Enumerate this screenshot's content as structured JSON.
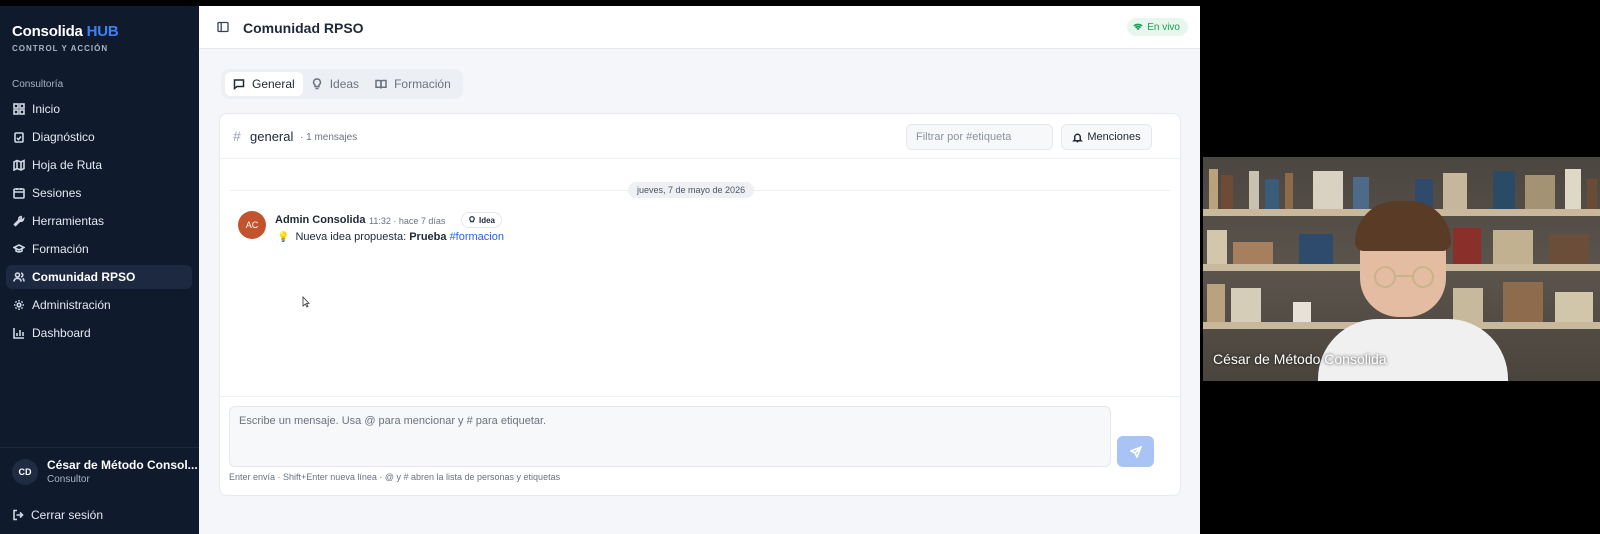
{
  "brand": {
    "name": "Consolida",
    "hub": "HUB",
    "tagline": "CONTROL Y ACCIÓN"
  },
  "sidebar": {
    "section": "Consultoría",
    "items": [
      {
        "label": "Inicio",
        "icon": "grid-icon"
      },
      {
        "label": "Diagnóstico",
        "icon": "clipboard-check-icon"
      },
      {
        "label": "Hoja de Ruta",
        "icon": "map-icon"
      },
      {
        "label": "Sesiones",
        "icon": "calendar-icon"
      },
      {
        "label": "Herramientas",
        "icon": "wrench-icon"
      },
      {
        "label": "Formación",
        "icon": "graduation-cap-icon"
      },
      {
        "label": "Comunidad RPSO",
        "icon": "users-icon",
        "active": true
      },
      {
        "label": "Administración",
        "icon": "gear-icon"
      },
      {
        "label": "Dashboard",
        "icon": "bar-chart-icon"
      }
    ],
    "user": {
      "initials": "CD",
      "name": "César de Método Consol...",
      "role": "Consultor"
    },
    "logout": "Cerrar sesión"
  },
  "header": {
    "title": "Comunidad RPSO",
    "status": "En vivo"
  },
  "tabs": [
    {
      "label": "General",
      "icon": "message-square-icon",
      "active": true
    },
    {
      "label": "Ideas",
      "icon": "lightbulb-icon"
    },
    {
      "label": "Formación",
      "icon": "book-open-icon"
    }
  ],
  "channel": {
    "hash": "#",
    "name": "general",
    "count": "· 1 mensajes",
    "filter_placeholder": "Filtrar por #etiqueta",
    "mentions_label": "Menciones"
  },
  "messages": {
    "date": "jueves, 7 de mayo de 2026",
    "items": [
      {
        "initials": "AC",
        "author": "Admin Consolida",
        "meta": "11:32 · hace 7 días",
        "tag": "Idea",
        "emoji": "💡",
        "text_prefix": "Nueva idea propuesta: ",
        "text_bold": "Prueba",
        "hashtag": "#formacion"
      }
    ]
  },
  "composer": {
    "placeholder": "Escribe un mensaje. Usa @ para mencionar y # para etiquetar.",
    "hint": "Enter envía · Shift+Enter nueva línea · @ y # abren la lista de personas y etiquetas"
  },
  "video": {
    "name": "César de Método Consolida"
  },
  "colors": {
    "sidebar_bg": "#0f1a2d",
    "accent": "#3b82f6",
    "live": "#1f9d55",
    "avatar": "#c2542d",
    "send": "#a9c3f5"
  }
}
